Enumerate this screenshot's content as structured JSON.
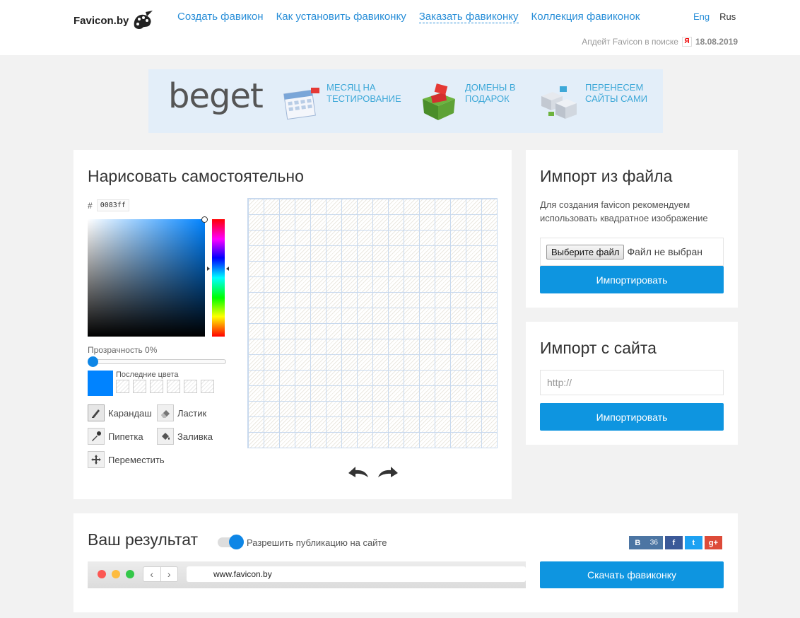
{
  "header": {
    "logo_text": "Favicon.by",
    "nav": [
      {
        "label": "Создать фавикон"
      },
      {
        "label": "Как установить фавиконку"
      },
      {
        "label": "Заказать фавиконку"
      },
      {
        "label": "Коллекция фавиконок"
      }
    ],
    "lang_eng": "Eng",
    "lang_rus": "Rus",
    "update_text": "Апдейт Favicon в поиске",
    "yandex_badge": "Я",
    "update_date": "18.08.2019"
  },
  "banner": {
    "brand": "beget",
    "promos": [
      {
        "text": "Месяц на тестирование",
        "icon": "calendar-icon"
      },
      {
        "text": "Домены в подарок",
        "icon": "gift-box-icon"
      },
      {
        "text": "Перенесем сайты сами",
        "icon": "servers-icon"
      }
    ]
  },
  "draw": {
    "title": "Нарисовать самостоятельно",
    "hex_prefix": "#",
    "hex_value": "0083ff",
    "opacity_label": "Прозрачность 0%",
    "opacity": 0,
    "recent_label": "Последние цвета",
    "tools": {
      "pencil": "Карандаш",
      "eraser": "Ластик",
      "pipette": "Пипетка",
      "fill": "Заливка",
      "move": "Переместить"
    },
    "current_color": "#0083ff",
    "grid_size": 16
  },
  "import_file": {
    "title": "Импорт из файла",
    "description": "Для создания favicon рекомендуем использовать квадратное изображение",
    "choose_button": "Выберите файл",
    "no_file": "Файл не выбран",
    "import_button": "Импортировать"
  },
  "import_site": {
    "title": "Импорт с сайта",
    "url_placeholder": "http://",
    "import_button": "Импортировать"
  },
  "result": {
    "title": "Ваш результат",
    "toggle_label": "Разрешить публикацию на сайте",
    "toggle_on": true,
    "vk_label": "В",
    "vk_count": "36",
    "fb_label": "f",
    "tw_label": "t",
    "gp_label": "g+",
    "browser_url": "www.favicon.by",
    "download_button": "Скачать фавиконку"
  },
  "colors": {
    "accent": "#0e95e0",
    "link": "#2a8fd8",
    "banner_bg": "#e3eef9"
  }
}
